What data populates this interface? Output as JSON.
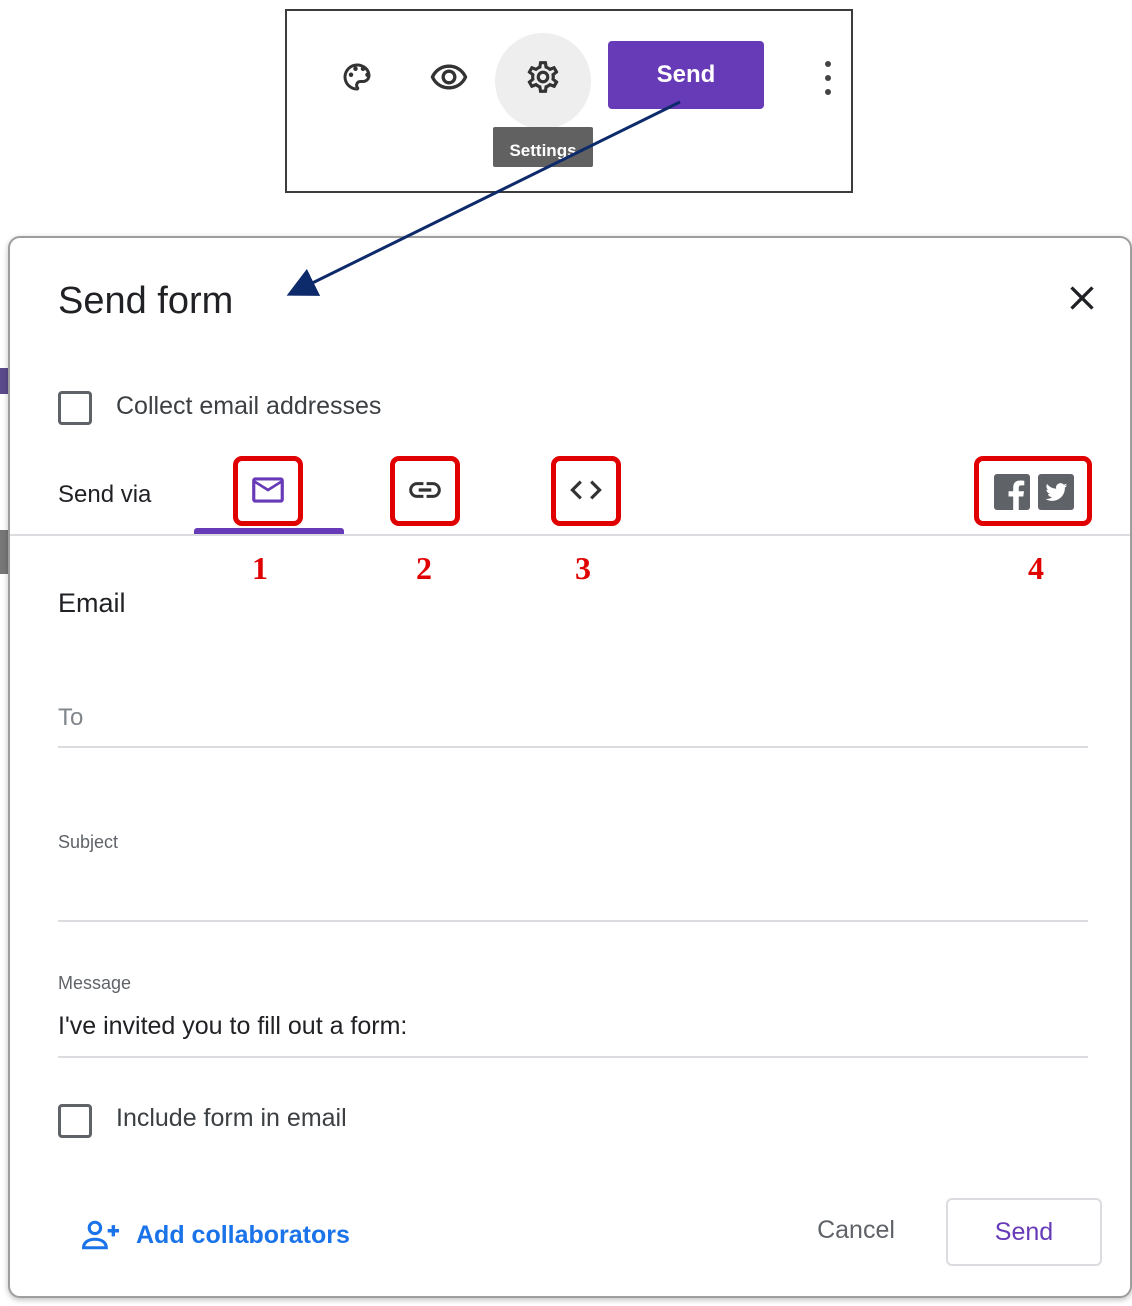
{
  "toolbar": {
    "send_label": "Send",
    "tooltip": "Settings",
    "icons": [
      "palette-icon",
      "eye-icon",
      "gear-icon",
      "more-vert-icon"
    ],
    "accent": "#673ab7"
  },
  "dialog": {
    "title": "Send form",
    "collect_email_label": "Collect email addresses",
    "send_via_label": "Send via",
    "tabs": [
      {
        "name": "email",
        "icon": "mail-icon",
        "annotation": "1",
        "selected": true
      },
      {
        "name": "link",
        "icon": "link-icon",
        "annotation": "2",
        "selected": false
      },
      {
        "name": "embed",
        "icon": "code-icon",
        "annotation": "3",
        "selected": false
      },
      {
        "name": "social",
        "icon": "facebook-twitter-icons",
        "annotation": "4",
        "selected": false
      }
    ],
    "section_title": "Email",
    "to_placeholder": "To",
    "subject_label": "Subject",
    "subject_value": "",
    "message_label": "Message",
    "message_value": "I've invited you to fill out a form:",
    "include_form_label": "Include form in email",
    "add_collaborators": "Add collaborators",
    "cancel": "Cancel",
    "send": "Send"
  },
  "colors": {
    "annotation_red": "#e00000",
    "link_blue": "#1a73e8",
    "primary_purple": "#673ab7"
  }
}
